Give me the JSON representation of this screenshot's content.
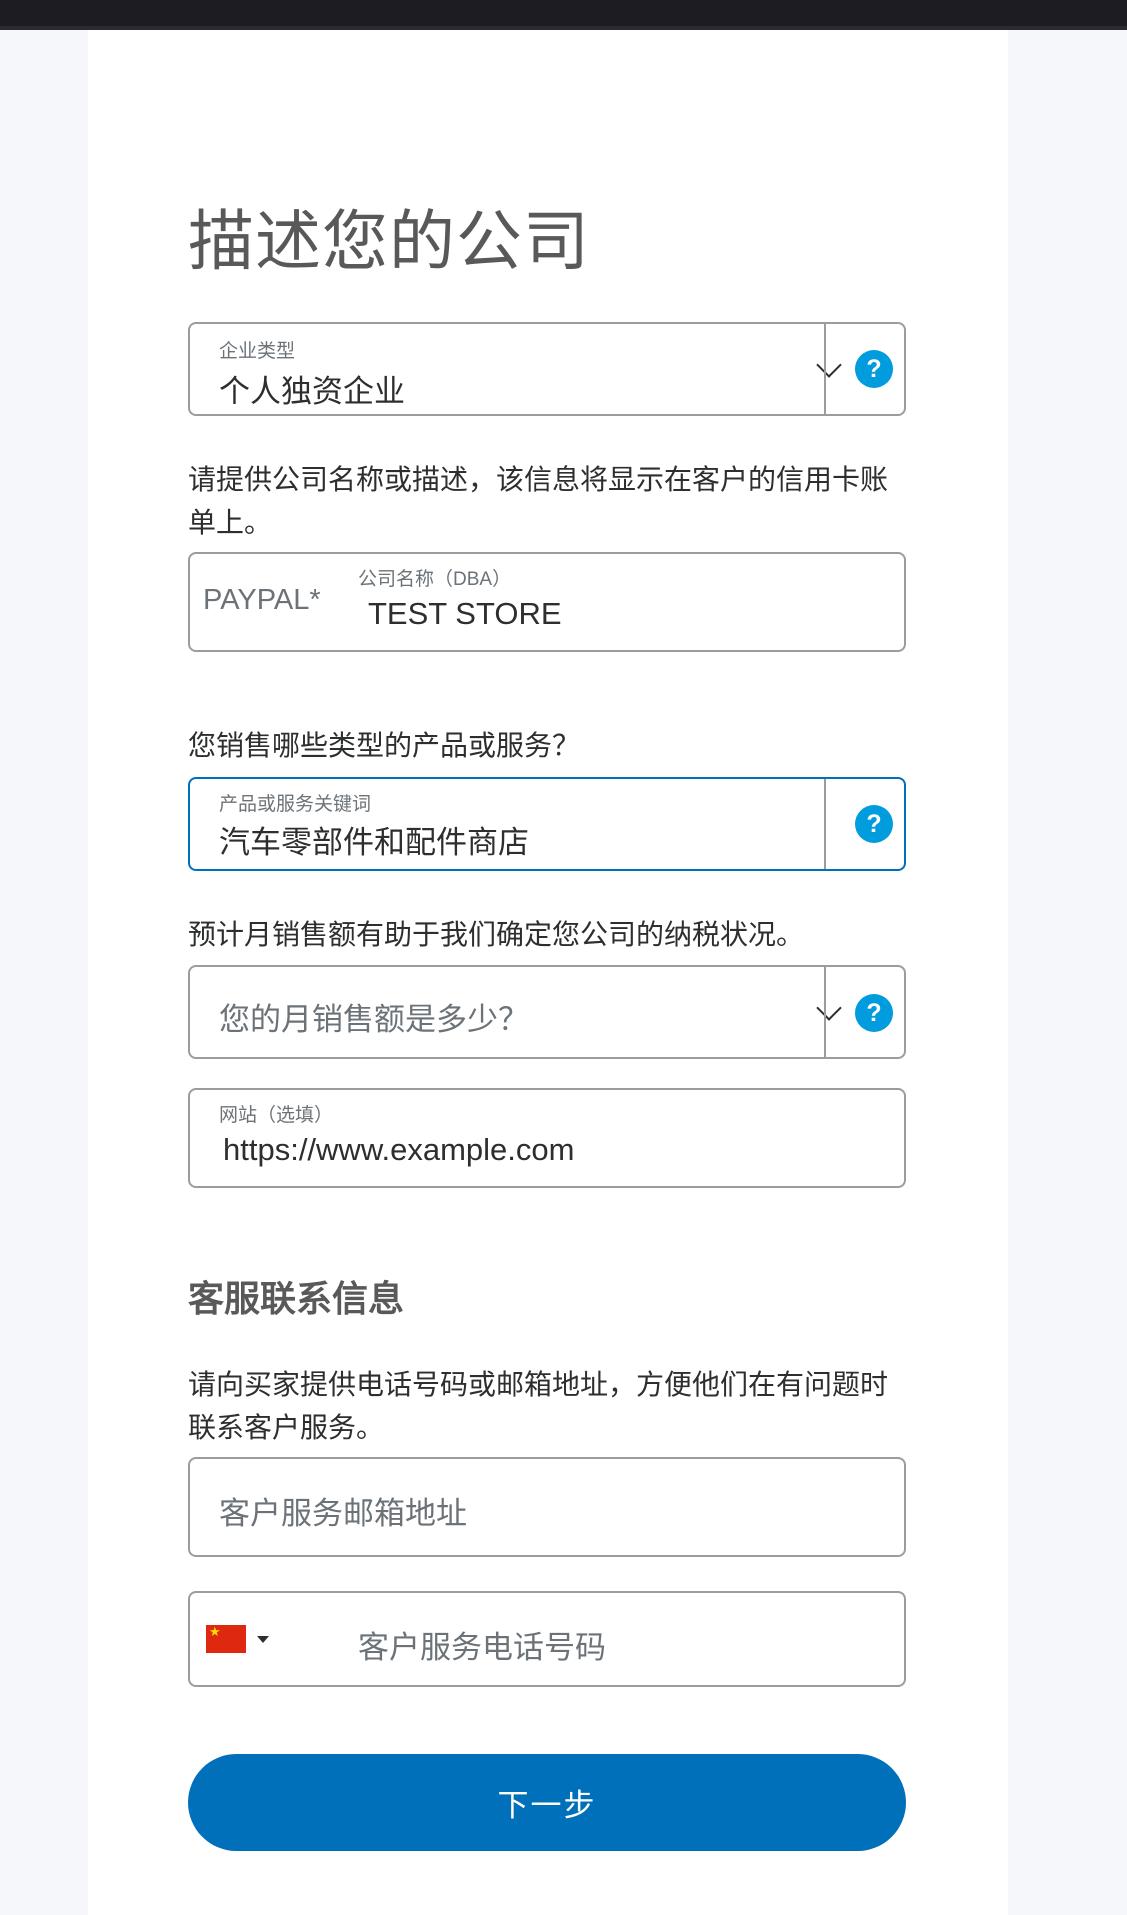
{
  "page": {
    "title": "描述您的公司"
  },
  "business_type": {
    "label": "企业类型",
    "value": "个人独资企业",
    "help": "?"
  },
  "business_name_hint": "请提供公司名称或描述，该信息将显示在客户的信用卡账单上。",
  "dba": {
    "prefix": "PAYPAL*",
    "label": "公司名称（DBA）",
    "value": "TEST STORE"
  },
  "products_question": "您销售哪些类型的产品或服务？",
  "products": {
    "label": "产品或服务关键词",
    "value": "汽车零部件和配件商店",
    "help": "?"
  },
  "sales_hint": "预计月销售额有助于我们确定您公司的纳税状况。",
  "monthly_sales": {
    "placeholder": "您的月销售额是多少？",
    "help": "?"
  },
  "website": {
    "label": "网站（选填）",
    "value": "https://www.example.com"
  },
  "customer_service": {
    "section_title": "客服联系信息",
    "hint": "请向买家提供电话号码或邮箱地址，方便他们在有问题时联系客户服务。",
    "email_placeholder": "客户服务邮箱地址",
    "phone_placeholder": "客户服务电话号码",
    "country": "China",
    "flag_star": "★"
  },
  "actions": {
    "next_label": "下一步"
  },
  "colors": {
    "accent": "#0070ba",
    "help_icon": "#009cde",
    "top_bar": "#1c1c22"
  }
}
